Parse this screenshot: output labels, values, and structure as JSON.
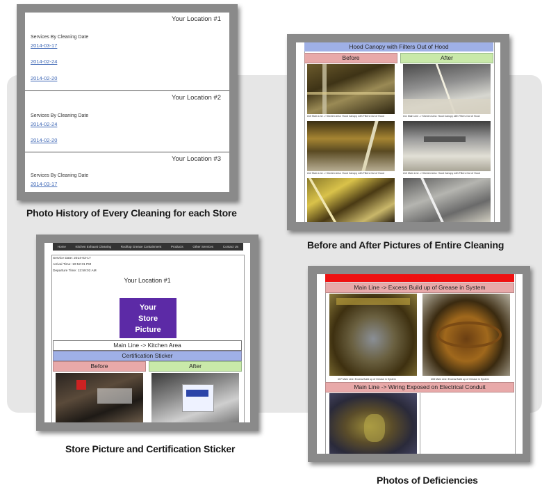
{
  "panel1": {
    "caption": "Photo History of Every Cleaning for each Store",
    "locations": [
      {
        "title": "Your Location #1",
        "heading": "Services By Cleaning Date",
        "dates": [
          "2014-03-17",
          "2014-02-24",
          "2014-02-20"
        ]
      },
      {
        "title": "Your Location #2",
        "heading": "Services By Cleaning Date",
        "dates": [
          "2014-02-24",
          "2014-02-20"
        ]
      },
      {
        "title": "Your Location #3",
        "heading": "Services By Cleaning Date",
        "dates": [
          "2014-03-17"
        ]
      }
    ]
  },
  "panel2": {
    "caption": "Before and After Pictures of Entire Cleaning",
    "header": "Hood Canopy with Filters Out of Hood",
    "before_label": "Before",
    "after_label": "After",
    "photo_captions": [
      "#10 Main Line -> Kitchen Area: Hood Canopy with Filters Out of Hood",
      "#11 Main Line -> Kitchen Area: Hood Canopy with Filters Out of Hood",
      "#12 Main Line -> Kitchen Area: Hood Canopy with Filters Out of Hood",
      "#13 Main Line -> Kitchen Area: Hood Canopy with Filters Out of Hood"
    ]
  },
  "panel3": {
    "caption": "Store Picture and Certification Sticker",
    "nav": [
      "Home",
      "Kitchen Exhaust Cleaning",
      "Rooftop Grease Containment",
      "Products",
      "Other Services",
      "Contact Us"
    ],
    "service_date": "Service Date: 2014-03-17",
    "arrival_time": "Arrival Time: 10:52:31 PM",
    "departure_time": "Departure Time: 12:59:02 AM",
    "location_title": "Your Location #1",
    "store_picture": [
      "Your",
      "Store",
      "Picture"
    ],
    "area": "Main Line -> Kitchen Area",
    "section": "Certification Sticker",
    "before_label": "Before",
    "after_label": "After"
  },
  "panel4": {
    "caption": "Photos of Deficiencies",
    "top_banner": "Deficiencies",
    "item1": "Main Line -> Excess Build up of Grease in System",
    "item1_captions": [
      "#07 Main Line: Excess Build up of Grease in System",
      "#08 Main Line: Excess Build up of Grease in System"
    ],
    "item2": "Main Line -> Wiring Exposed on Electrical Conduit"
  },
  "colors": {
    "before": "#e8a9a9",
    "after": "#c9e9a9",
    "header_blue": "#9fb0e6",
    "deficiency_red": "#ee1111",
    "store_purple": "#5c2aa6"
  }
}
